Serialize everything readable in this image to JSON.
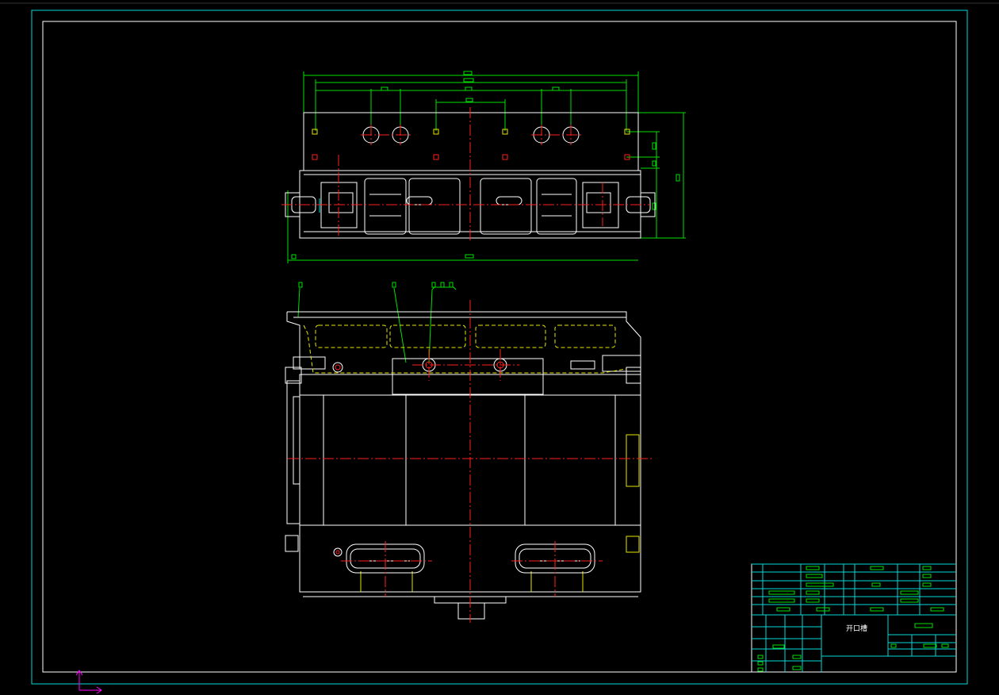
{
  "drawing": {
    "title_block": {
      "drawing_name": "开口槽"
    }
  }
}
